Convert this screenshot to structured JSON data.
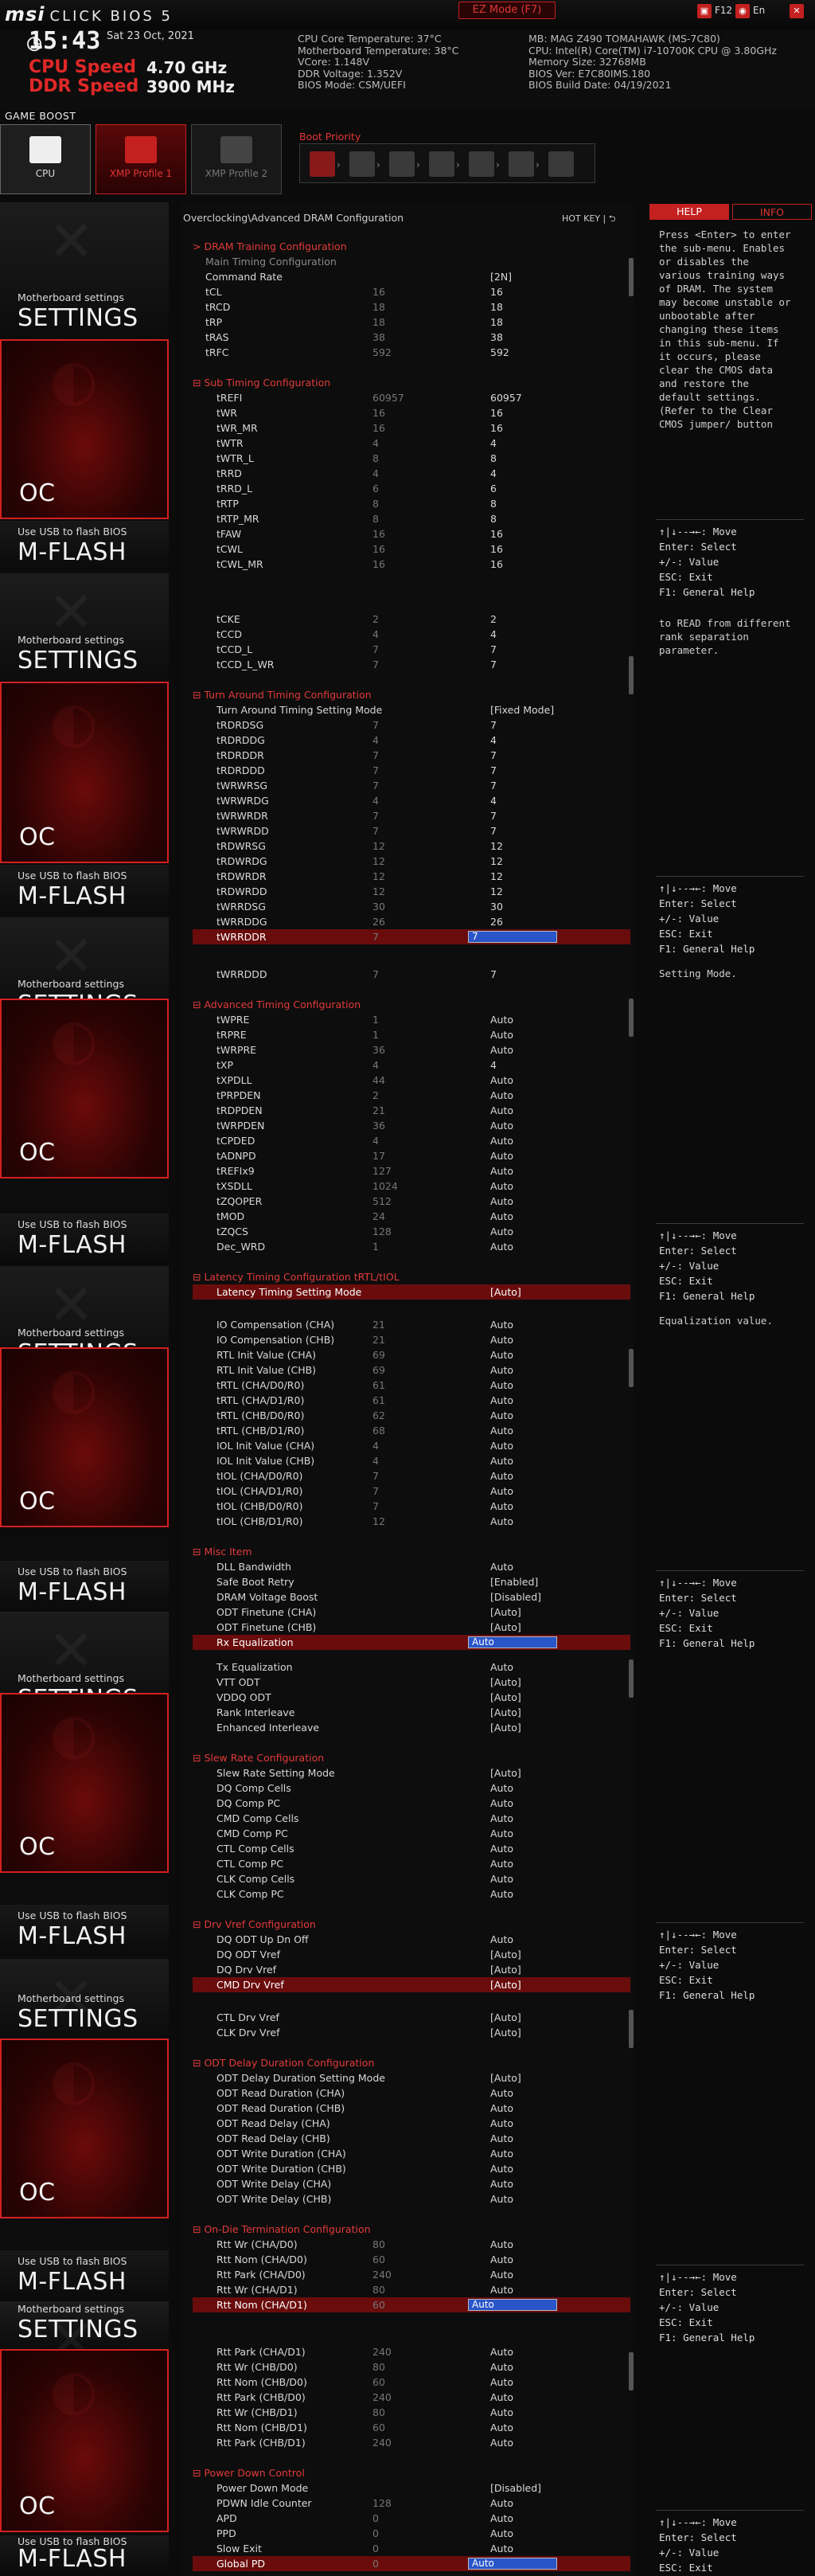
{
  "header": {
    "logo_brand": "msi",
    "logo_product": "CLICK BIOS 5",
    "ez_mode": "EZ Mode (F7)",
    "f12": "F12",
    "lang": "En"
  },
  "status": {
    "time": "15:43",
    "date": "Sat 23 Oct, 2021",
    "cpu_speed_label": "CPU Speed",
    "cpu_speed_value": "4.70 GHz",
    "ddr_speed_label": "DDR Speed",
    "ddr_speed_value": "3900 MHz",
    "left_info": [
      "CPU Core Temperature: 37°C",
      "Motherboard Temperature: 38°C",
      "VCore: 1.148V",
      "DDR Voltage: 1.352V",
      "BIOS Mode: CSM/UEFI"
    ],
    "right_info": [
      "MB: MAG Z490 TOMAHAWK (MS-7C80)",
      "CPU: Intel(R) Core(TM) i7-10700K CPU @ 3.80GHz",
      "Memory Size: 32768MB",
      "BIOS Ver: E7C80IMS.180",
      "BIOS Build Date: 04/19/2021"
    ]
  },
  "game_boost": {
    "label": "GAME BOOST",
    "tabs": [
      "CPU",
      "XMP Profile 1",
      "XMP Profile 2"
    ],
    "boot_priority": "Boot Priority"
  },
  "sidebar": {
    "settings_small": "Motherboard settings",
    "settings_big": "SETTINGS",
    "oc_big": "OC",
    "mflash_small": "Use USB to flash BIOS",
    "mflash_big": "M-FLASH"
  },
  "main": {
    "breadcrumb": "Overclocking\\Advanced DRAM Configuration",
    "hotkey": "HOT KEY  |  ⮌",
    "rows": [
      [
        "> DRAM Training Configuration",
        "",
        "",
        "s"
      ],
      [
        "Main Timing Configuration",
        "",
        "",
        "g"
      ],
      [
        "Command Rate",
        "",
        "[2N]",
        ""
      ],
      [
        "tCL",
        "16",
        "16",
        ""
      ],
      [
        "tRCD",
        "18",
        "18",
        ""
      ],
      [
        "tRP",
        "18",
        "18",
        ""
      ],
      [
        "tRAS",
        "38",
        "38",
        ""
      ],
      [
        "tRFC",
        "592",
        "592",
        ""
      ],
      [
        "",
        "",
        "",
        ""
      ],
      [
        "⊟ Sub Timing Configuration",
        "",
        "",
        "s"
      ],
      [
        "tREFI",
        "60957",
        "60957",
        "i"
      ],
      [
        "tWR",
        "16",
        "16",
        "i"
      ],
      [
        "tWR_MR",
        "16",
        "16",
        "i"
      ],
      [
        "tWTR",
        "4",
        "4",
        "i"
      ],
      [
        "tWTR_L",
        "8",
        "8",
        "i"
      ],
      [
        "tRRD",
        "4",
        "4",
        "i"
      ],
      [
        "tRRD_L",
        "6",
        "6",
        "i"
      ],
      [
        "tRTP",
        "8",
        "8",
        "i"
      ],
      [
        "tRTP_MR",
        "8",
        "8",
        "i"
      ],
      [
        "tFAW",
        "16",
        "16",
        "i"
      ],
      [
        "tCWL",
        "16",
        "16",
        "i"
      ],
      [
        "tCWL_MR",
        "16",
        "16",
        "i"
      ]
    ],
    "rows2": [
      [
        "tCKE",
        "2",
        "2",
        "i"
      ],
      [
        "tCCD",
        "4",
        "4",
        "i"
      ],
      [
        "tCCD_L",
        "7",
        "7",
        "i"
      ],
      [
        "tCCD_L_WR",
        "7",
        "7",
        "i"
      ],
      [
        "",
        "",
        "",
        ""
      ],
      [
        "⊟ Turn Around Timing Configuration",
        "",
        "",
        "s"
      ],
      [
        "Turn Around Timing Setting Mode",
        "",
        "[Fixed Mode]",
        "i"
      ],
      [
        "tRDRDSG",
        "7",
        "7",
        "i"
      ],
      [
        "tRDRDDG",
        "4",
        "4",
        "i"
      ],
      [
        "tRDRDDR",
        "7",
        "7",
        "i"
      ],
      [
        "tRDRDDD",
        "7",
        "7",
        "i"
      ],
      [
        "tWRWRSG",
        "7",
        "7",
        "i"
      ],
      [
        "tWRWRDG",
        "4",
        "4",
        "i"
      ],
      [
        "tWRWRDR",
        "7",
        "7",
        "i"
      ],
      [
        "tWRWRDD",
        "7",
        "7",
        "i"
      ],
      [
        "tRDWRSG",
        "12",
        "12",
        "i"
      ],
      [
        "tRDWRDG",
        "12",
        "12",
        "i"
      ],
      [
        "tRDWRDR",
        "12",
        "12",
        "i"
      ],
      [
        "tRDWRDD",
        "12",
        "12",
        "i"
      ],
      [
        "tWRRDSG",
        "30",
        "30",
        "i"
      ],
      [
        "tWRRDDG",
        "26",
        "26",
        "i"
      ],
      [
        "tWRRDDR",
        "7",
        "7",
        "x"
      ]
    ],
    "rows3": [
      [
        "tWRRDDD",
        "7",
        "7",
        "i"
      ],
      [
        "",
        "",
        "",
        ""
      ],
      [
        "⊟ Advanced Timing Configuration",
        "",
        "",
        "s"
      ],
      [
        "tWPRE",
        "1",
        "Auto",
        "i"
      ],
      [
        "tRPRE",
        "1",
        "Auto",
        "i"
      ],
      [
        "tWRPRE",
        "36",
        "Auto",
        "i"
      ],
      [
        "tXP",
        "4",
        "4",
        "i"
      ],
      [
        "tXPDLL",
        "44",
        "Auto",
        "i"
      ],
      [
        "tPRPDEN",
        "2",
        "Auto",
        "i"
      ],
      [
        "tRDPDEN",
        "21",
        "Auto",
        "i"
      ],
      [
        "tWRPDEN",
        "36",
        "Auto",
        "i"
      ],
      [
        "tCPDED",
        "4",
        "Auto",
        "i"
      ],
      [
        "tADNPD",
        "17",
        "Auto",
        "i"
      ],
      [
        "tREFIx9",
        "127",
        "Auto",
        "i"
      ],
      [
        "tXSDLL",
        "1024",
        "Auto",
        "i"
      ],
      [
        "tZQOPER",
        "512",
        "Auto",
        "i"
      ],
      [
        "tMOD",
        "24",
        "Auto",
        "i"
      ],
      [
        "tZQCS",
        "128",
        "Auto",
        "i"
      ],
      [
        "Dec_WRD",
        "1",
        "Auto",
        "i"
      ],
      [
        "",
        "",
        "",
        ""
      ],
      [
        "⊟ Latency Timing Configuration tRTL/tIOL",
        "",
        "",
        "s"
      ],
      [
        "Latency Timing Setting Mode",
        "",
        "[Auto]",
        "h"
      ]
    ],
    "rows4": [
      [
        "IO Compensation (CHA)",
        "21",
        "Auto",
        "i"
      ],
      [
        "IO Compensation (CHB)",
        "21",
        "Auto",
        "i"
      ],
      [
        "RTL Init Value (CHA)",
        "69",
        "Auto",
        "i"
      ],
      [
        "RTL Init Value (CHB)",
        "69",
        "Auto",
        "i"
      ],
      [
        "tRTL (CHA/D0/R0)",
        "61",
        "Auto",
        "i"
      ],
      [
        "tRTL (CHA/D1/R0)",
        "61",
        "Auto",
        "i"
      ],
      [
        "tRTL (CHB/D0/R0)",
        "62",
        "Auto",
        "i"
      ],
      [
        "tRTL (CHB/D1/R0)",
        "68",
        "Auto",
        "i"
      ],
      [
        "IOL Init Value (CHA)",
        "4",
        "Auto",
        "i"
      ],
      [
        "IOL Init Value (CHB)",
        "4",
        "Auto",
        "i"
      ],
      [
        "tIOL (CHA/D0/R0)",
        "7",
        "Auto",
        "i"
      ],
      [
        "tIOL (CHA/D1/R0)",
        "7",
        "Auto",
        "i"
      ],
      [
        "tIOL (CHB/D0/R0)",
        "7",
        "Auto",
        "i"
      ],
      [
        "tIOL (CHB/D1/R0)",
        "12",
        "Auto",
        "i"
      ],
      [
        "",
        "",
        "",
        ""
      ],
      [
        "⊟ Misc Item",
        "",
        "",
        "s"
      ],
      [
        "DLL Bandwidth",
        "",
        "Auto",
        "i"
      ],
      [
        "Safe Boot Retry",
        "",
        "[Enabled]",
        "i"
      ],
      [
        "DRAM Voltage Boost",
        "",
        "[Disabled]",
        "i"
      ],
      [
        "ODT Finetune (CHA)",
        "",
        "[Auto]",
        "i"
      ],
      [
        "ODT Finetune (CHB)",
        "",
        "[Auto]",
        "i"
      ],
      [
        "Rx Equalization",
        "",
        "Auto",
        "x"
      ]
    ],
    "rows5": [
      [
        "Tx Equalization",
        "",
        "Auto",
        "i"
      ],
      [
        "VTT ODT",
        "",
        "[Auto]",
        "i"
      ],
      [
        "VDDQ ODT",
        "",
        "[Auto]",
        "i"
      ],
      [
        "Rank Interleave",
        "",
        "[Auto]",
        "i"
      ],
      [
        "Enhanced Interleave",
        "",
        "[Auto]",
        "i"
      ],
      [
        "",
        "",
        "",
        ""
      ],
      [
        "⊟ Slew Rate Configuration",
        "",
        "",
        "s"
      ],
      [
        "Slew Rate Setting Mode",
        "",
        "[Auto]",
        "i"
      ],
      [
        "DQ Comp Cells",
        "",
        "Auto",
        "i"
      ],
      [
        "DQ Comp PC",
        "",
        "Auto",
        "i"
      ],
      [
        "CMD Comp Cells",
        "",
        "Auto",
        "i"
      ],
      [
        "CMD Comp PC",
        "",
        "Auto",
        "i"
      ],
      [
        "CTL Comp Cells",
        "",
        "Auto",
        "i"
      ],
      [
        "CTL Comp PC",
        "",
        "Auto",
        "i"
      ],
      [
        "CLK Comp Cells",
        "",
        "Auto",
        "i"
      ],
      [
        "CLK Comp PC",
        "",
        "Auto",
        "i"
      ],
      [
        "",
        "",
        "",
        ""
      ],
      [
        "⊟ Drv Vref Configuration",
        "",
        "",
        "s"
      ],
      [
        "DQ ODT Up Dn Off",
        "",
        "Auto",
        "i"
      ],
      [
        "DQ ODT Vref",
        "",
        "[Auto]",
        "i"
      ],
      [
        "DQ Drv Vref",
        "",
        "[Auto]",
        "i"
      ],
      [
        "CMD Drv Vref",
        "",
        "[Auto]",
        "h"
      ]
    ],
    "rows6": [
      [
        "CTL Drv Vref",
        "",
        "[Auto]",
        "i"
      ],
      [
        "CLK Drv Vref",
        "",
        "[Auto]",
        "i"
      ],
      [
        "",
        "",
        "",
        ""
      ],
      [
        "⊟ ODT Delay Duration Configuration",
        "",
        "",
        "s"
      ],
      [
        "ODT Delay Duration Setting Mode",
        "",
        "[Auto]",
        "i"
      ],
      [
        "ODT Read Duration (CHA)",
        "",
        "Auto",
        "i"
      ],
      [
        "ODT Read Duration (CHB)",
        "",
        "Auto",
        "i"
      ],
      [
        "ODT Read Delay (CHA)",
        "",
        "Auto",
        "i"
      ],
      [
        "ODT Read Delay (CHB)",
        "",
        "Auto",
        "i"
      ],
      [
        "ODT Write Duration (CHA)",
        "",
        "Auto",
        "i"
      ],
      [
        "ODT Write Duration (CHB)",
        "",
        "Auto",
        "i"
      ],
      [
        "ODT Write Delay (CHA)",
        "",
        "Auto",
        "i"
      ],
      [
        "ODT Write Delay (CHB)",
        "",
        "Auto",
        "i"
      ],
      [
        "",
        "",
        "",
        ""
      ],
      [
        "⊟ On-Die Termination Configuration",
        "",
        "",
        "s"
      ],
      [
        "Rtt Wr (CHA/D0)",
        "80",
        "Auto",
        "i"
      ],
      [
        "Rtt Nom (CHA/D0)",
        "60",
        "Auto",
        "i"
      ],
      [
        "Rtt Park (CHA/D0)",
        "240",
        "Auto",
        "i"
      ],
      [
        "Rtt Wr (CHA/D1)",
        "80",
        "Auto",
        "i"
      ],
      [
        "Rtt Nom (CHA/D1)",
        "60",
        "Auto",
        "x"
      ]
    ],
    "rows7": [
      [
        "Rtt Park (CHA/D1)",
        "240",
        "Auto",
        "i"
      ],
      [
        "Rtt Wr (CHB/D0)",
        "80",
        "Auto",
        "i"
      ],
      [
        "Rtt Nom (CHB/D0)",
        "60",
        "Auto",
        "i"
      ],
      [
        "Rtt Park (CHB/D0)",
        "240",
        "Auto",
        "i"
      ],
      [
        "Rtt Wr (CHB/D1)",
        "80",
        "Auto",
        "i"
      ],
      [
        "Rtt Nom (CHB/D1)",
        "60",
        "Auto",
        "i"
      ],
      [
        "Rtt Park (CHB/D1)",
        "240",
        "Auto",
        "i"
      ],
      [
        "",
        "",
        "",
        ""
      ],
      [
        "⊟ Power Down Control",
        "",
        "",
        "s"
      ],
      [
        "Power Down Mode",
        "",
        "[Disabled]",
        "i"
      ],
      [
        "PDWN Idle Counter",
        "128",
        "Auto",
        "i"
      ],
      [
        "APD",
        "0",
        "Auto",
        "i"
      ],
      [
        "PPD",
        "0",
        "Auto",
        "i"
      ],
      [
        "Slow Exit",
        "0",
        "Auto",
        "i"
      ],
      [
        "Global PD",
        "0",
        "Auto",
        "x"
      ]
    ]
  },
  "help": {
    "tab_help": "HELP",
    "tab_info": "INFO",
    "text1": "Press <Enter> to enter the sub-menu. Enables or disables the various training ways of DRAM. The system may become unstable or unbootable after changing these items in this sub-menu. If it occurs, please clear the CMOS data and restore the default settings. (Refer to the Clear CMOS jumper/ button",
    "keys_full": "↑|↓--→←: Move\nEnter: Select\n+/-: Value\nESC: Exit\nF1: General Help",
    "text2": "to READ from different rank separation parameter.",
    "text3": "Setting Mode.",
    "text4": "Equalization value."
  }
}
